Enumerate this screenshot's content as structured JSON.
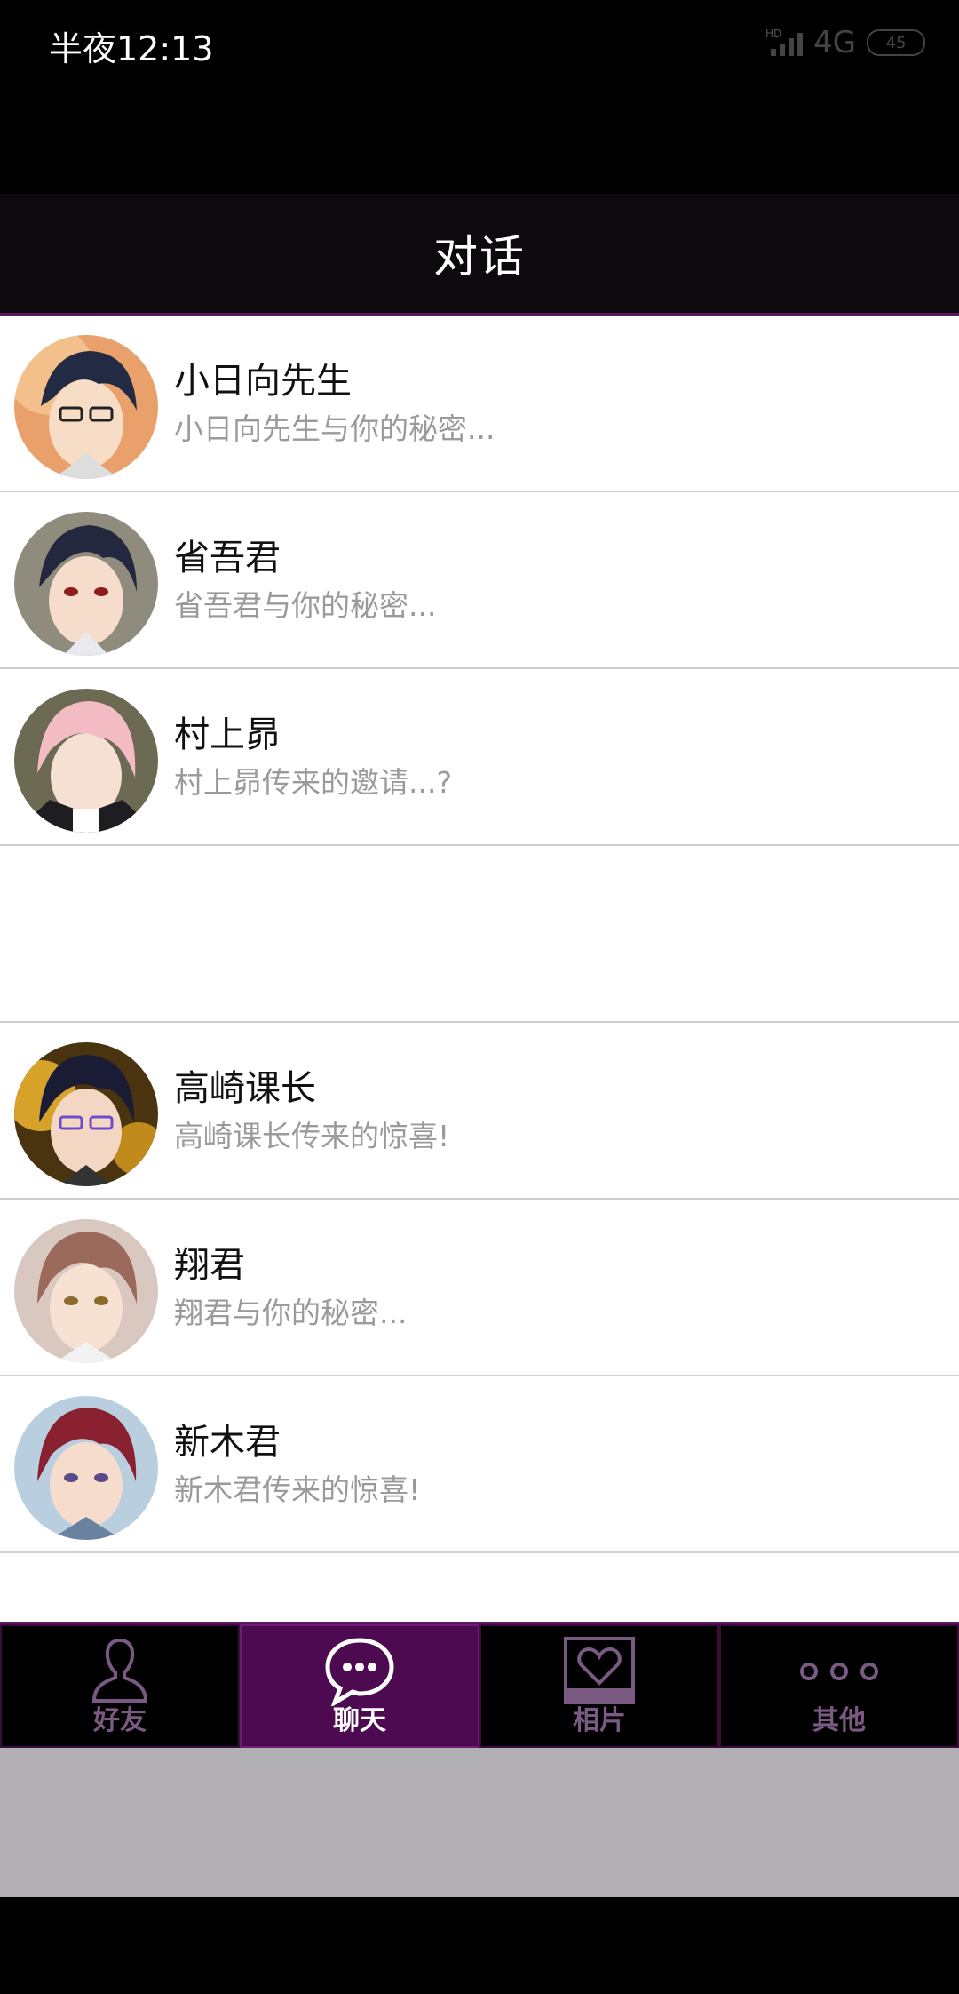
{
  "status": {
    "time": "半夜12:13",
    "hd": "HD",
    "network": "4G",
    "battery": "45"
  },
  "header": {
    "title": "对话"
  },
  "conversations": [
    {
      "name": "小日向先生",
      "preview": "小日向先生与你的秘密...",
      "avatar_icon": "character-avatar-glasses"
    },
    {
      "name": "省吾君",
      "preview": "省吾君与你的秘密...",
      "avatar_icon": "character-avatar-darkhair"
    },
    {
      "name": "村上昴",
      "preview": "村上昴传来的邀请...?",
      "avatar_icon": "character-avatar-pinkhair"
    },
    {
      "name": "高崎课长",
      "preview": "高崎课长传来的惊喜!",
      "avatar_icon": "character-avatar-glasses-gold"
    },
    {
      "name": "翔君",
      "preview": "翔君与你的秘密...",
      "avatar_icon": "character-avatar-brownhair"
    },
    {
      "name": "新木君",
      "preview": "新木君传来的惊喜!",
      "avatar_icon": "character-avatar-redhair"
    }
  ],
  "tabs": [
    {
      "label": "好友",
      "icon": "person-icon",
      "active": false
    },
    {
      "label": "聊天",
      "icon": "chat-bubble-icon",
      "active": true
    },
    {
      "label": "相片",
      "icon": "photo-heart-icon",
      "active": false
    },
    {
      "label": "其他",
      "icon": "more-dots-icon",
      "active": false
    }
  ],
  "colors": {
    "accent": "#5a1760",
    "active_tab": "#4d0a50",
    "preview_text": "#9a9a9a"
  }
}
